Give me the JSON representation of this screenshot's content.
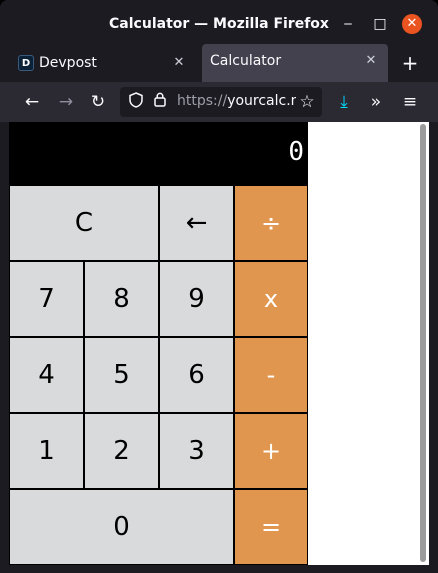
{
  "window": {
    "title": "Calculator — Mozilla Firefox",
    "minimize": "‒",
    "maximize": "□",
    "close": "✕"
  },
  "tabs": [
    {
      "favicon": "D",
      "label": "Devpost",
      "close": "✕"
    },
    {
      "label": "Calculator",
      "close": "✕"
    }
  ],
  "new_tab": "+",
  "nav": {
    "back": "←",
    "forward": "→",
    "reload": "↻",
    "url_scheme": "https://",
    "url_host": "yourcalc.n",
    "bookmark": "☆",
    "download": "⤓",
    "overflow": "»",
    "menu": "≡"
  },
  "calculator": {
    "display": "0",
    "keys": {
      "clear": "C",
      "backspace": "←",
      "divide": "÷",
      "seven": "7",
      "eight": "8",
      "nine": "9",
      "multiply": "x",
      "four": "4",
      "five": "5",
      "six": "6",
      "subtract": "-",
      "one": "1",
      "two": "2",
      "three": "3",
      "add": "+",
      "zero": "0",
      "equals": "="
    }
  },
  "colors": {
    "operator": "#e0964f",
    "key": "#d9dadb",
    "display_bg": "#000000",
    "close_button": "#e95420"
  },
  "icons": {
    "shield": "shield-icon",
    "lock": "lock-icon"
  }
}
